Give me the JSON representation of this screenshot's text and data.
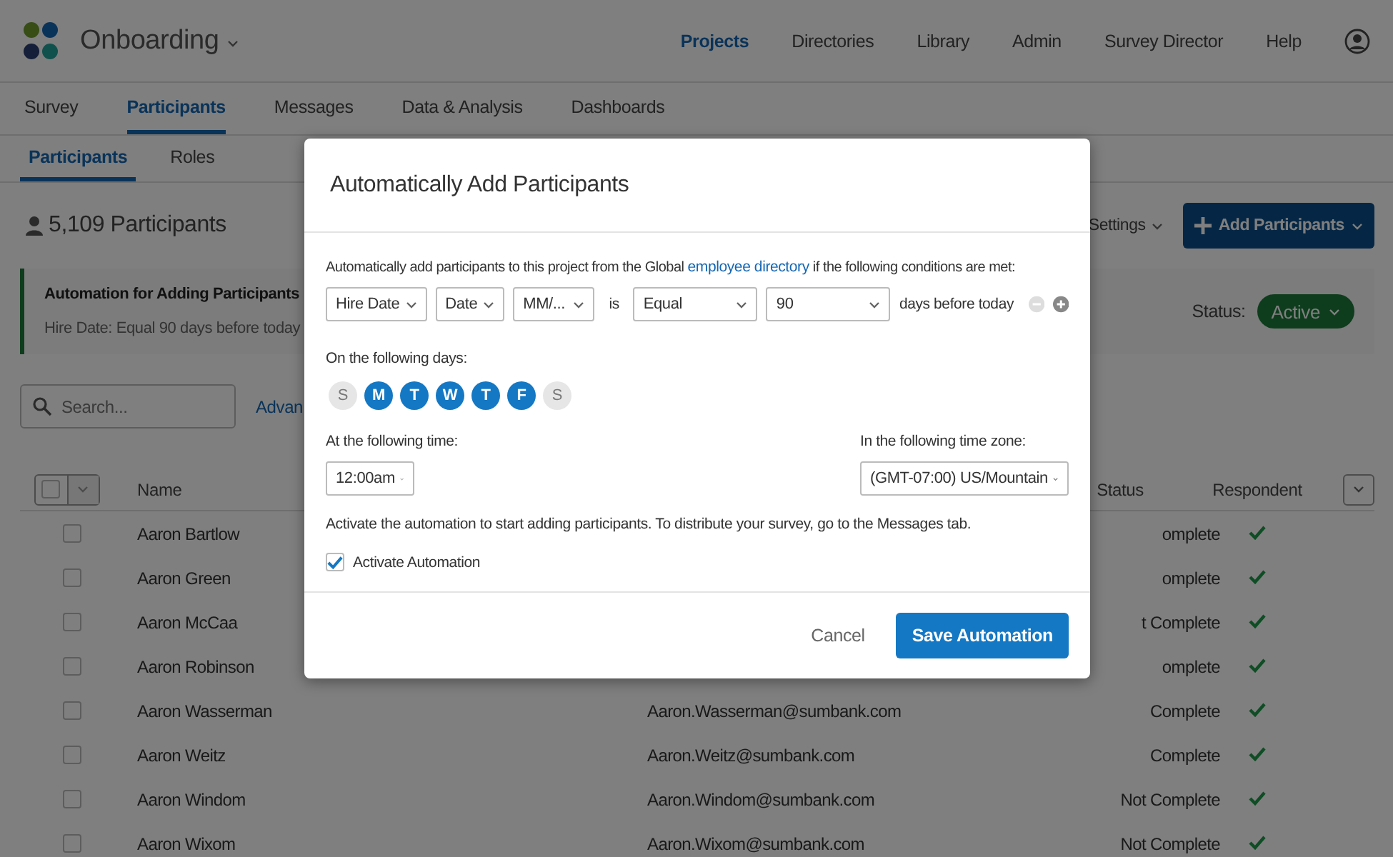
{
  "app": {
    "project": "Onboarding"
  },
  "nav": [
    {
      "label": "Projects",
      "selected": true
    },
    {
      "label": "Directories",
      "selected": false
    },
    {
      "label": "Library",
      "selected": false
    },
    {
      "label": "Admin",
      "selected": false
    },
    {
      "label": "Survey Director",
      "selected": false
    },
    {
      "label": "Help",
      "selected": false
    }
  ],
  "tabs": [
    {
      "label": "Survey",
      "selected": false
    },
    {
      "label": "Participants",
      "selected": true
    },
    {
      "label": "Messages",
      "selected": false
    },
    {
      "label": "Data & Analysis",
      "selected": false
    },
    {
      "label": "Dashboards",
      "selected": false
    }
  ],
  "subtabs": [
    {
      "label": "Participants",
      "selected": true
    },
    {
      "label": "Roles",
      "selected": false
    }
  ],
  "participant_count": "5,109 Participants",
  "toolbar": {
    "settings": "Settings",
    "add_button": "Add Participants"
  },
  "automation_card": {
    "title": "Automation for Adding Participants",
    "summary": "Hire Date: Equal 90 days before today",
    "status_label": "Status:",
    "status": "Active"
  },
  "search": {
    "placeholder": "Search..."
  },
  "advanced_link": "Advan",
  "table": {
    "columns": [
      "Name",
      "Status",
      "Respondent"
    ],
    "rows": [
      {
        "name": "Aaron Bartlow",
        "checked": false,
        "status": "omplete",
        "respondent": true
      },
      {
        "name": "Aaron Green",
        "checked": false,
        "status": "omplete",
        "respondent": true
      },
      {
        "name": "Aaron McCaa",
        "checked": false,
        "status": "t Complete",
        "respondent": true
      },
      {
        "name": "Aaron Robinson",
        "checked": false,
        "status": "omplete",
        "respondent": true
      },
      {
        "name": "Aaron Wasserman",
        "checked": false,
        "email": "Aaron.Wasserman@sumbank.com",
        "status": "Complete",
        "respondent": true
      },
      {
        "name": "Aaron Weitz",
        "checked": false,
        "email": "Aaron.Weitz@sumbank.com",
        "status": "Complete",
        "respondent": true
      },
      {
        "name": "Aaron Windom",
        "checked": false,
        "email": "Aaron.Windom@sumbank.com",
        "status": "Not Complete",
        "respondent": true
      },
      {
        "name": "Aaron Wixom",
        "checked": false,
        "email": "Aaron.Wixom@sumbank.com",
        "status": "Not Complete",
        "respondent": true
      }
    ]
  },
  "modal": {
    "title": "Automatically Add Participants",
    "intro_before": "Automatically add participants to this project from the Global ",
    "intro_link": "employee directory",
    "intro_after": " if the following conditions are met:",
    "condition": {
      "field": "Hire Date",
      "type": "Date",
      "format": "MM/...",
      "operator_label": "is",
      "operator": "Equal",
      "value": "90",
      "suffix": "days before today",
      "remove_disabled": true
    },
    "days_label": "On the following days:",
    "days": [
      {
        "label": "S",
        "selected": false
      },
      {
        "label": "M",
        "selected": true
      },
      {
        "label": "T",
        "selected": true
      },
      {
        "label": "W",
        "selected": true
      },
      {
        "label": "T",
        "selected": true
      },
      {
        "label": "F",
        "selected": true
      },
      {
        "label": "S",
        "selected": false
      }
    ],
    "time_label": "At the following time:",
    "time": "12:00am",
    "timezone_label": "In the following time zone:",
    "timezone": "(GMT-07:00) US/Mountain",
    "note": "Activate the automation to start adding participants. To distribute your survey, go to the Messages tab.",
    "activate": {
      "label": "Activate Automation",
      "checked": true
    },
    "cancel": "Cancel",
    "save": "Save Automation"
  }
}
